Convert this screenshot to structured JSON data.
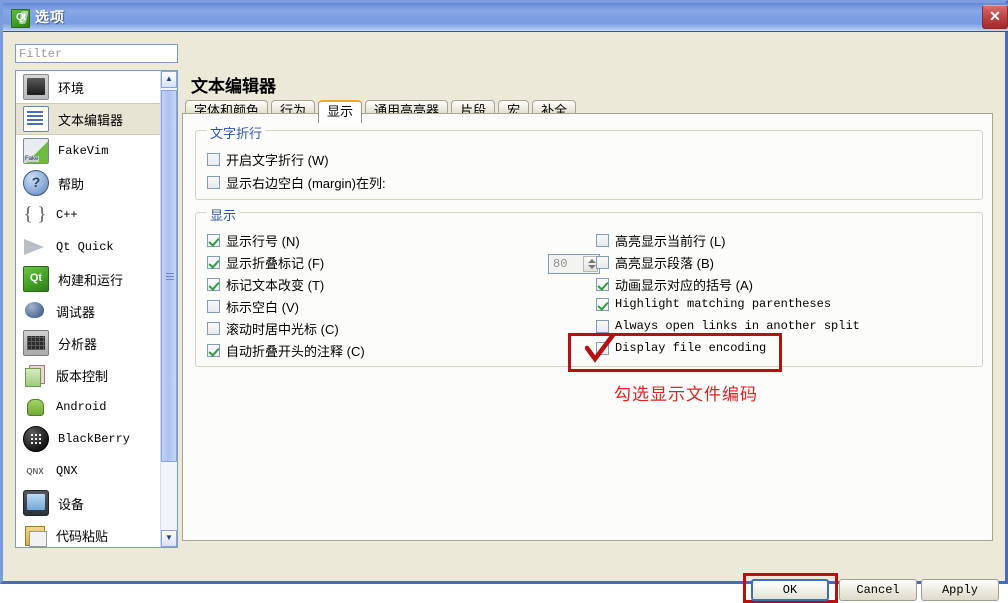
{
  "window": {
    "title": "选项",
    "icon": "qt-logo-icon",
    "close_label": "✕"
  },
  "sidebar": {
    "filter": {
      "value": "",
      "placeholder": "Filter"
    },
    "items": [
      {
        "label": "环境",
        "icon": "monitor-icon",
        "mono": false,
        "selected": false
      },
      {
        "label": "文本编辑器",
        "icon": "text-editor-icon",
        "mono": false,
        "selected": true
      },
      {
        "label": "FakeVim",
        "icon": "fakevim-icon",
        "mono": true,
        "selected": false
      },
      {
        "label": "帮助",
        "icon": "help-question-icon",
        "mono": false,
        "selected": false
      },
      {
        "label": "C++",
        "icon": "braces-icon",
        "mono": true,
        "selected": false
      },
      {
        "label": "Qt Quick",
        "icon": "qtquick-icon",
        "mono": true,
        "selected": false
      },
      {
        "label": "构建和运行",
        "icon": "build-run-icon",
        "mono": false,
        "selected": false
      },
      {
        "label": "调试器",
        "icon": "debugger-bug-icon",
        "mono": false,
        "selected": false
      },
      {
        "label": "分析器",
        "icon": "analyzer-icon",
        "mono": false,
        "selected": false
      },
      {
        "label": "版本控制",
        "icon": "version-control-icon",
        "mono": false,
        "selected": false
      },
      {
        "label": "Android",
        "icon": "android-icon",
        "mono": true,
        "selected": false
      },
      {
        "label": "BlackBerry",
        "icon": "blackberry-icon",
        "mono": true,
        "selected": false
      },
      {
        "label": "QNX",
        "icon": "qnx-icon",
        "mono": true,
        "selected": false
      },
      {
        "label": "设备",
        "icon": "device-icon",
        "mono": false,
        "selected": false
      },
      {
        "label": "代码粘贴",
        "icon": "code-paste-icon",
        "mono": false,
        "selected": false
      }
    ],
    "scrollbar": {
      "up_glyph": "▲",
      "down_glyph": "▼"
    }
  },
  "main": {
    "page_title": "文本编辑器",
    "tabs": [
      {
        "label": "字体和颜色",
        "active": false
      },
      {
        "label": "行为",
        "active": false
      },
      {
        "label": "显示",
        "active": true
      },
      {
        "label": "通用高亮器",
        "active": false
      },
      {
        "label": "片段",
        "active": false
      },
      {
        "label": "宏",
        "active": false
      },
      {
        "label": "补全",
        "active": false
      }
    ],
    "groups": [
      {
        "title": "文字折行",
        "checkboxes": [
          {
            "label": "开启文字折行 (W)",
            "checked": false,
            "mono": false
          },
          {
            "label": "显示右边空白 (margin)在列:",
            "checked": false,
            "mono": false
          }
        ],
        "spinbox": {
          "value": "80"
        }
      },
      {
        "title": "显示",
        "left_column": [
          {
            "label": "显示行号 (N)",
            "checked": true,
            "mono": false
          },
          {
            "label": "显示折叠标记 (F)",
            "checked": true,
            "mono": false
          },
          {
            "label": "标记文本改变 (T)",
            "checked": true,
            "mono": false
          },
          {
            "label": "标示空白 (V)",
            "checked": false,
            "mono": false
          },
          {
            "label": "滚动时居中光标 (C)",
            "checked": false,
            "mono": false
          },
          {
            "label": "自动折叠开头的注释 (C)",
            "checked": true,
            "mono": false
          }
        ],
        "right_column": [
          {
            "label": "高亮显示当前行 (L)",
            "checked": false,
            "mono": false
          },
          {
            "label": "高亮显示段落 (B)",
            "checked": false,
            "mono": false
          },
          {
            "label": "动画显示对应的括号 (A)",
            "checked": true,
            "mono": false
          },
          {
            "label": "Highlight matching parentheses",
            "checked": true,
            "mono": true
          },
          {
            "label": "Always open links in another split",
            "checked": false,
            "mono": true
          },
          {
            "label": "Display file encoding",
            "checked": true,
            "mono": true
          }
        ]
      }
    ]
  },
  "annotations": {
    "color": "#b81010",
    "note_color": "#e02222",
    "note_text": "勾选显示文件编码",
    "highlight_checkbox": "Display file encoding",
    "highlight_button": "OK"
  },
  "footer": {
    "buttons": [
      {
        "label": "OK",
        "primary": true
      },
      {
        "label": "Cancel",
        "primary": false
      },
      {
        "label": "Apply",
        "primary": false
      }
    ]
  }
}
